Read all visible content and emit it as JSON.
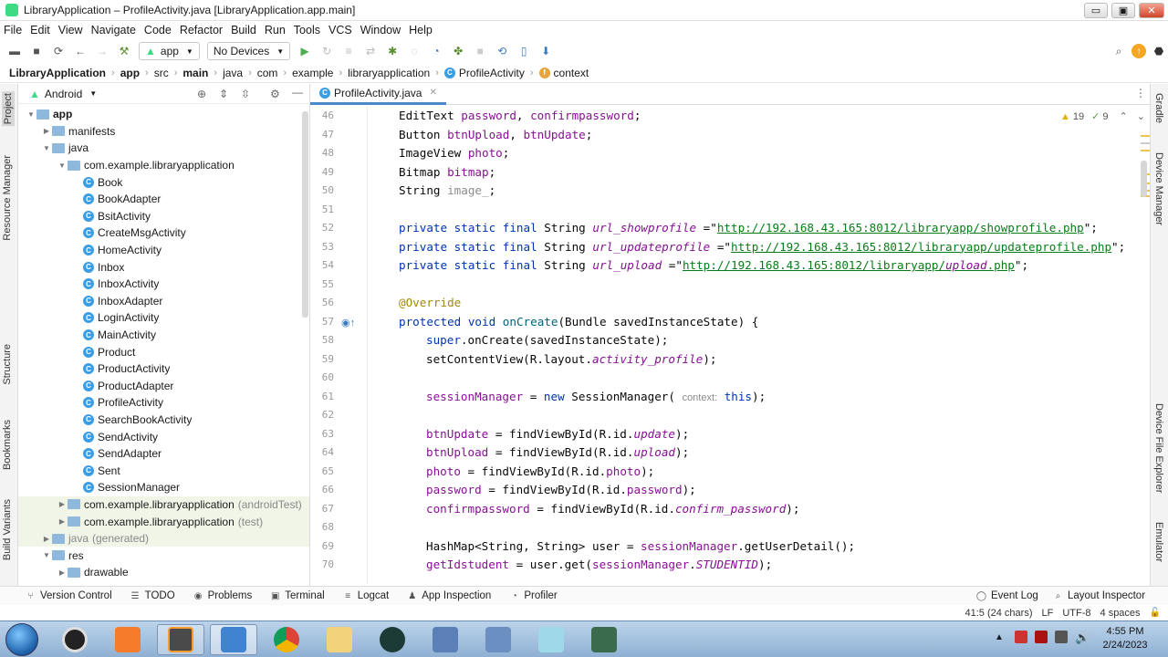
{
  "window": {
    "title": "LibraryApplication – ProfileActivity.java [LibraryApplication.app.main]",
    "min": "▭",
    "max": "▣",
    "close": "✕"
  },
  "menu": [
    "File",
    "Edit",
    "View",
    "Navigate",
    "Code",
    "Refactor",
    "Build",
    "Run",
    "Tools",
    "VCS",
    "Window",
    "Help"
  ],
  "toolbar": {
    "module": "app",
    "device": "No Devices"
  },
  "breadcrumb": [
    "LibraryApplication",
    "app",
    "src",
    "main",
    "java",
    "com",
    "example",
    "libraryapplication",
    "ProfileActivity",
    "context"
  ],
  "project_panel": {
    "view": "Android",
    "tree": [
      {
        "label": "app",
        "level": 0,
        "expanded": true,
        "type": "folder",
        "bold": true
      },
      {
        "label": "manifests",
        "level": 1,
        "expanded": false,
        "type": "folder"
      },
      {
        "label": "java",
        "level": 1,
        "expanded": true,
        "type": "folder"
      },
      {
        "label": "com.example.libraryapplication",
        "level": 2,
        "expanded": true,
        "type": "folder"
      },
      {
        "label": "Book",
        "level": 3,
        "type": "class"
      },
      {
        "label": "BookAdapter",
        "level": 3,
        "type": "class"
      },
      {
        "label": "BsitActivity",
        "level": 3,
        "type": "class"
      },
      {
        "label": "CreateMsgActivity",
        "level": 3,
        "type": "class"
      },
      {
        "label": "HomeActivity",
        "level": 3,
        "type": "class"
      },
      {
        "label": "Inbox",
        "level": 3,
        "type": "class"
      },
      {
        "label": "InboxActivity",
        "level": 3,
        "type": "class"
      },
      {
        "label": "InboxAdapter",
        "level": 3,
        "type": "class"
      },
      {
        "label": "LoginActivity",
        "level": 3,
        "type": "class"
      },
      {
        "label": "MainActivity",
        "level": 3,
        "type": "class"
      },
      {
        "label": "Product",
        "level": 3,
        "type": "class"
      },
      {
        "label": "ProductActivity",
        "level": 3,
        "type": "class"
      },
      {
        "label": "ProductAdapter",
        "level": 3,
        "type": "class"
      },
      {
        "label": "ProfileActivity",
        "level": 3,
        "type": "class"
      },
      {
        "label": "SearchBookActivity",
        "level": 3,
        "type": "class"
      },
      {
        "label": "SendActivity",
        "level": 3,
        "type": "class"
      },
      {
        "label": "SendAdapter",
        "level": 3,
        "type": "class"
      },
      {
        "label": "Sent",
        "level": 3,
        "type": "class"
      },
      {
        "label": "SessionManager",
        "level": 3,
        "type": "class"
      },
      {
        "label": "com.example.libraryapplication",
        "suffix": "(androidTest)",
        "level": 2,
        "expanded": false,
        "type": "folder"
      },
      {
        "label": "com.example.libraryapplication",
        "suffix": "(test)",
        "level": 2,
        "expanded": false,
        "type": "folder"
      },
      {
        "label": "java",
        "suffix": "(generated)",
        "level": 1,
        "expanded": false,
        "type": "folder",
        "muted": true
      },
      {
        "label": "res",
        "level": 1,
        "expanded": true,
        "type": "folder"
      },
      {
        "label": "drawable",
        "level": 2,
        "expanded": false,
        "type": "folder"
      }
    ]
  },
  "left_tabs": [
    "Project",
    "Resource Manager",
    "Structure",
    "Bookmarks",
    "Build Variants"
  ],
  "right_tabs": [
    "Gradle",
    "Device Manager",
    "Device File Explorer",
    "Emulator"
  ],
  "editor": {
    "tab": "ProfileActivity.java",
    "warnings": "19",
    "weak_warnings": "9",
    "lines": [
      {
        "n": "46",
        "code": "EditText password, confirmpassword;"
      },
      {
        "n": "47",
        "code": "Button btnUpload, btnUpdate;"
      },
      {
        "n": "48",
        "code": "ImageView photo;"
      },
      {
        "n": "49",
        "code": "Bitmap bitmap;"
      },
      {
        "n": "50",
        "code": "String image_;"
      },
      {
        "n": "51",
        "code": ""
      },
      {
        "n": "52",
        "code": "private static final String url_showprofile =\"http://192.168.43.165:8012/libraryapp/showprofile.php\";"
      },
      {
        "n": "53",
        "code": "private static final String url_updateprofile =\"http://192.168.43.165:8012/libraryapp/updateprofile.php\";"
      },
      {
        "n": "54",
        "code": "private static final String url_upload =\"http://192.168.43.165:8012/libraryapp/upload.php\";"
      },
      {
        "n": "55",
        "code": ""
      },
      {
        "n": "56",
        "code": "@Override"
      },
      {
        "n": "57",
        "code": "protected void onCreate(Bundle savedInstanceState) {"
      },
      {
        "n": "58",
        "code": "super.onCreate(savedInstanceState);"
      },
      {
        "n": "59",
        "code": "setContentView(R.layout.activity_profile);"
      },
      {
        "n": "60",
        "code": ""
      },
      {
        "n": "61",
        "code": "sessionManager = new SessionManager( context: this);"
      },
      {
        "n": "62",
        "code": ""
      },
      {
        "n": "63",
        "code": "btnUpdate = findViewById(R.id.update);"
      },
      {
        "n": "64",
        "code": "btnUpload = findViewById(R.id.upload);"
      },
      {
        "n": "65",
        "code": "photo = findViewById(R.id.photo);"
      },
      {
        "n": "66",
        "code": "password = findViewById(R.id.password);"
      },
      {
        "n": "67",
        "code": "confirmpassword = findViewById(R.id.confirm_password);"
      },
      {
        "n": "68",
        "code": ""
      },
      {
        "n": "69",
        "code": "HashMap<String, String> user = sessionManager.getUserDetail();"
      },
      {
        "n": "70",
        "code": "getIdstudent = user.get(sessionManager.STUDENTID);"
      }
    ]
  },
  "bottom_tools": [
    "Version Control",
    "TODO",
    "Problems",
    "Terminal",
    "Logcat",
    "App Inspection",
    "Profiler"
  ],
  "bottom_right": [
    "Event Log",
    "Layout Inspector"
  ],
  "status": {
    "position": "41:5 (24 chars)",
    "line_sep": "LF",
    "encoding": "UTF-8",
    "indent": "4 spaces"
  },
  "clock": {
    "time": "4:55 PM",
    "date": "2/24/2023"
  }
}
